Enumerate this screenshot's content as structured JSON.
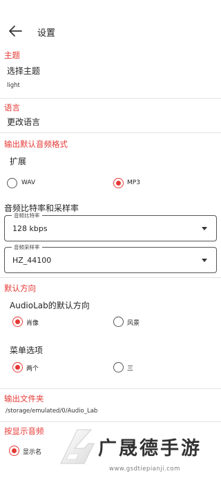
{
  "appbar": {
    "title": "设置",
    "back_icon": "arrow-left-icon"
  },
  "theme": {
    "header": "主题",
    "pref_title": "选择主题",
    "pref_summary": "light"
  },
  "language": {
    "header": "语言",
    "pref_title": "更改语言"
  },
  "output_format": {
    "header": "输出默认音频格式",
    "extension_title": "扩展",
    "options": [
      {
        "label": "WAV",
        "selected": false
      },
      {
        "label": "MP3",
        "selected": true
      }
    ],
    "bitrate_title": "音频比特率和采样率",
    "bitrate_dropdown": {
      "label": "音频比特率",
      "value": "128 kbps"
    },
    "samplerate_dropdown": {
      "label": "音频采样率",
      "value": "HZ_44100"
    }
  },
  "orientation": {
    "header": "默认方向",
    "title": "AudioLab的默认方向",
    "options": [
      {
        "label": "肖像",
        "selected": true
      },
      {
        "label": "风景",
        "selected": false
      }
    ],
    "menu_title": "菜单选项",
    "menu_options": [
      {
        "label": "两个",
        "selected": true
      },
      {
        "label": "三",
        "selected": false
      }
    ]
  },
  "output_folder": {
    "header": "输出文件夹",
    "path": "/storage/emulated/0/Audio_Lab"
  },
  "display_by": {
    "header": "按显示音频",
    "option_label": "显示名"
  },
  "watermark": {
    "name": "广晟德手游",
    "url": "www.gsdtiepianji.com"
  },
  "colors": {
    "accent": "#e53935",
    "divider": "#e3e3e3"
  }
}
